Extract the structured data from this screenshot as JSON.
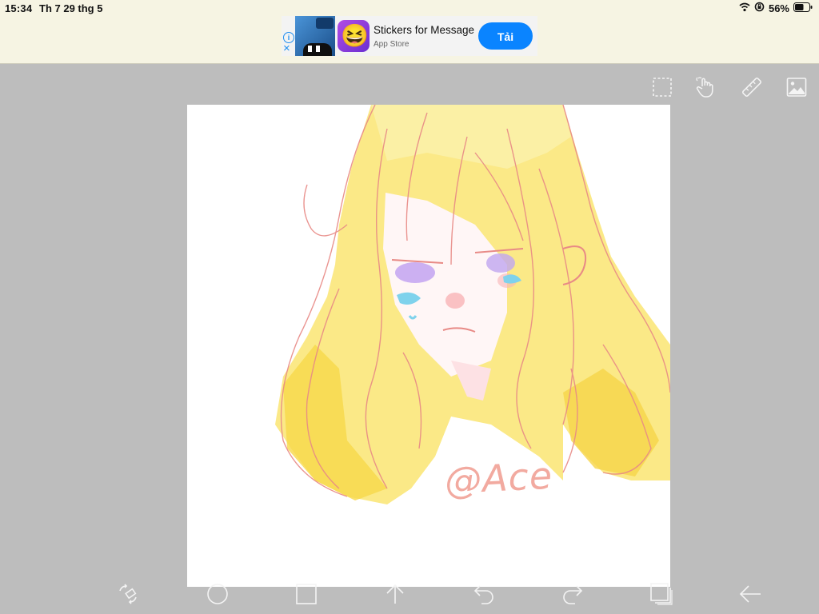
{
  "status_bar": {
    "time": "15:34",
    "date": "Th 7 29 thg 5",
    "battery": "56%"
  },
  "ad": {
    "title": "Stickers for Message",
    "subtitle": "App Store",
    "cta": "Tải",
    "info_glyph": "i",
    "close_glyph": "×",
    "app_icon_emoji": "😆"
  },
  "canvas": {
    "signature": "@Ace"
  },
  "icons": {
    "top_tools": [
      "selection-marquee-icon",
      "hand-gesture-icon",
      "ruler-icon",
      "image-icon"
    ],
    "bottom_tools": [
      "transform-icon",
      "ellipse-tool-icon",
      "rectangle-tool-icon",
      "arrow-up-icon",
      "undo-icon",
      "redo-icon",
      "layers-icon",
      "back-arrow-icon"
    ]
  },
  "colors": {
    "workspace": "#bdbdbd",
    "status_bg": "#f6f4e3",
    "cta": "#0a84ff",
    "hair_fill": "#fbe77a",
    "line": "#e88a86"
  }
}
